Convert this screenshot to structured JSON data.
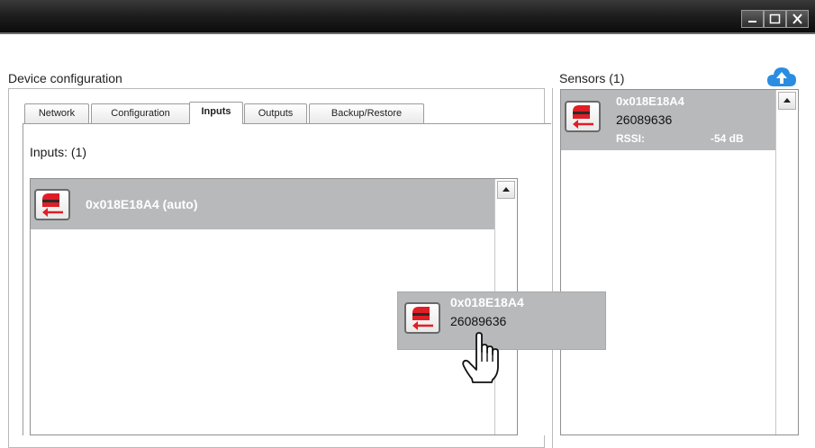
{
  "window": {
    "controls": [
      "minimize",
      "maximize",
      "close"
    ]
  },
  "device_configuration": {
    "title": "Device configuration",
    "tabs": [
      {
        "label": "Network"
      },
      {
        "label": "Configuration"
      },
      {
        "label": "Inputs"
      },
      {
        "label": "Outputs"
      },
      {
        "label": "Backup/Restore"
      }
    ],
    "active_tab": "Inputs",
    "inputs": {
      "heading": "Inputs: (1)",
      "items": [
        {
          "label": "0x018E18A4 (auto)",
          "icon": "sensor-input-icon"
        }
      ]
    }
  },
  "sensors": {
    "title": "Sensors (1)",
    "cloud_icon": "cloud-upload-icon",
    "items": [
      {
        "id": "0x018E18A4",
        "serial": "26089636",
        "rssi_label": "RSSI:",
        "rssi_value": "-54 dB",
        "icon": "sensor-input-icon"
      }
    ]
  },
  "drag_ghost": {
    "id": "0x018E18A4",
    "serial": "26089636",
    "cursor": "hand-pointer-icon"
  },
  "colors": {
    "selection": "#b7b9bb",
    "accent_red": "#e01e25",
    "cloud_blue": "#2a8de0"
  }
}
